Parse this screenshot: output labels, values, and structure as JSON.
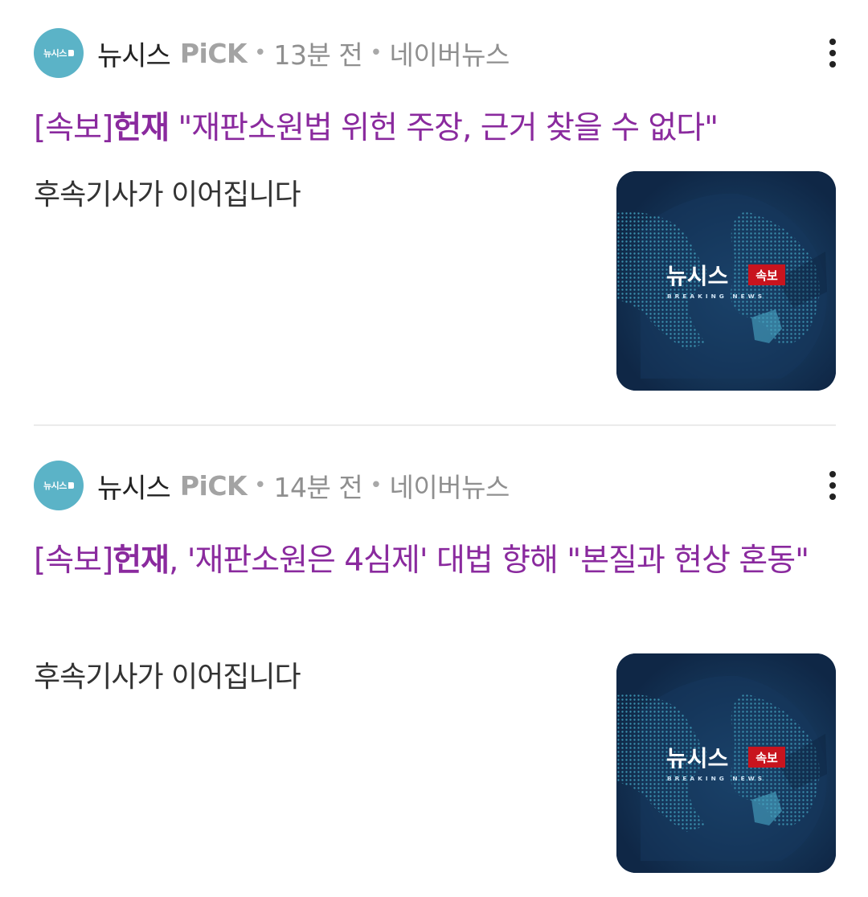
{
  "articles": [
    {
      "press_name": "뉴시스",
      "press_logo_text": "뉴시스",
      "pick_label": "PiCK",
      "time": "13분 전",
      "source": "네이버뉴스",
      "headline_prefix": "[속보]",
      "headline_bold": "헌재",
      "headline_rest": " \"재판소원법 위헌 주장, 근거 찾을 수 없다\"",
      "body": "후속기사가 이어집니다",
      "thumb": {
        "logo": "뉴시스",
        "badge": "속보",
        "subtitle": "BREAKING NEWS"
      }
    },
    {
      "press_name": "뉴시스",
      "press_logo_text": "뉴시스",
      "pick_label": "PiCK",
      "time": "14분 전",
      "source": "네이버뉴스",
      "headline_prefix": "[속보]",
      "headline_bold": "헌재",
      "headline_rest": ", '재판소원은 4심제' 대법 향해 \"본질과 현상 혼동\"",
      "body": "후속기사가 이어집니다",
      "thumb": {
        "logo": "뉴시스",
        "badge": "속보",
        "subtitle": "BREAKING NEWS"
      }
    }
  ],
  "colors": {
    "headline": "#8a2a9e",
    "avatar": "#5bb3c7",
    "thumb_bg": "#102a4c",
    "badge": "#c8141e"
  },
  "icons": {
    "more": "more-vertical-icon",
    "avatar": "press-logo-icon"
  }
}
